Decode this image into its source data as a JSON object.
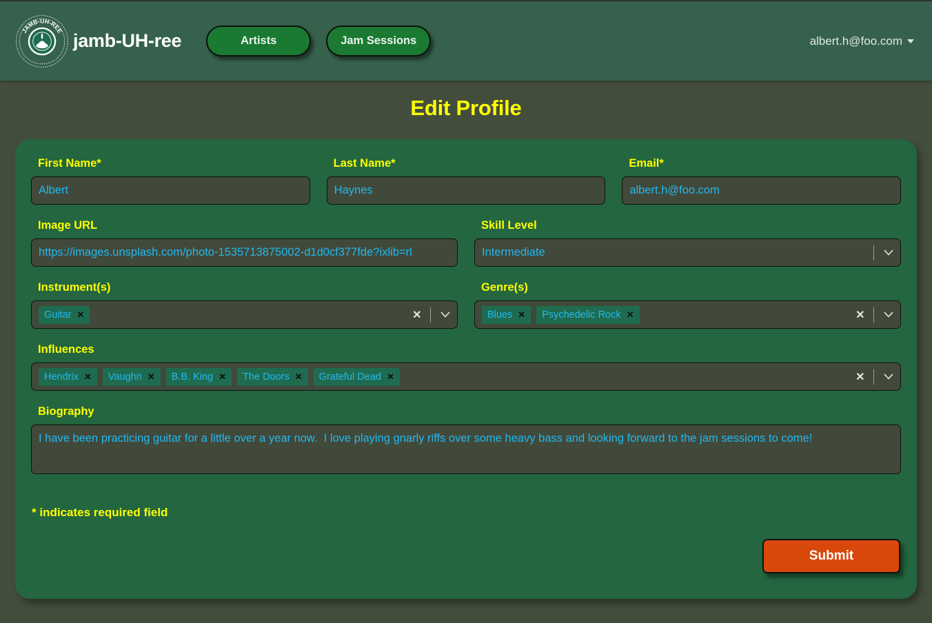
{
  "header": {
    "brand_name": "jamb-UH-ree",
    "logo_seal_text": "JAMB-UH-REE",
    "nav": [
      {
        "label": "Artists",
        "name": "nav-artists"
      },
      {
        "label": "Jam Sessions",
        "name": "nav-jam-sessions"
      }
    ],
    "user_email": "albert.h@foo.com"
  },
  "page": {
    "title": "Edit Profile",
    "required_note": "* indicates required field",
    "submit_label": "Submit"
  },
  "form": {
    "first_name": {
      "label": "First Name*",
      "value": "Albert"
    },
    "last_name": {
      "label": "Last Name*",
      "value": "Haynes"
    },
    "email": {
      "label": "Email*",
      "value": "albert.h@foo.com"
    },
    "image_url": {
      "label": "Image URL",
      "value": "https://images.unsplash.com/photo-1535713875002-d1d0cf377fde?ixlib=rl"
    },
    "skill_level": {
      "label": "Skill Level",
      "value": "Intermediate"
    },
    "instruments": {
      "label": "Instrument(s)",
      "chips": [
        "Guitar"
      ]
    },
    "genres": {
      "label": "Genre(s)",
      "chips": [
        "Blues",
        "Psychedelic Rock"
      ]
    },
    "influences": {
      "label": "Influences",
      "chips": [
        "Hendrix",
        "Vaughn",
        "B.B. King",
        "The Doors",
        "Grateful Dead"
      ]
    },
    "biography": {
      "label": "Biography",
      "value": "I have been practicing guitar for a little over a year now.  I love playing gnarly riffs over some heavy bass and looking forward to the jam sessions to come!"
    }
  },
  "icons": {
    "chevron_down": "⌄",
    "clear": "✕",
    "chip_remove": "✕"
  },
  "colors": {
    "page_bg": "#434d3c",
    "navbar_bg": "#36614c",
    "card_bg": "#23663f",
    "label_yellow": "#ffff00",
    "input_bg": "#41493a",
    "input_text": "#22b8ef",
    "nav_button": "#1b7a32",
    "submit_orange": "#d9480b",
    "chip_bg": "#1f6b4f"
  }
}
